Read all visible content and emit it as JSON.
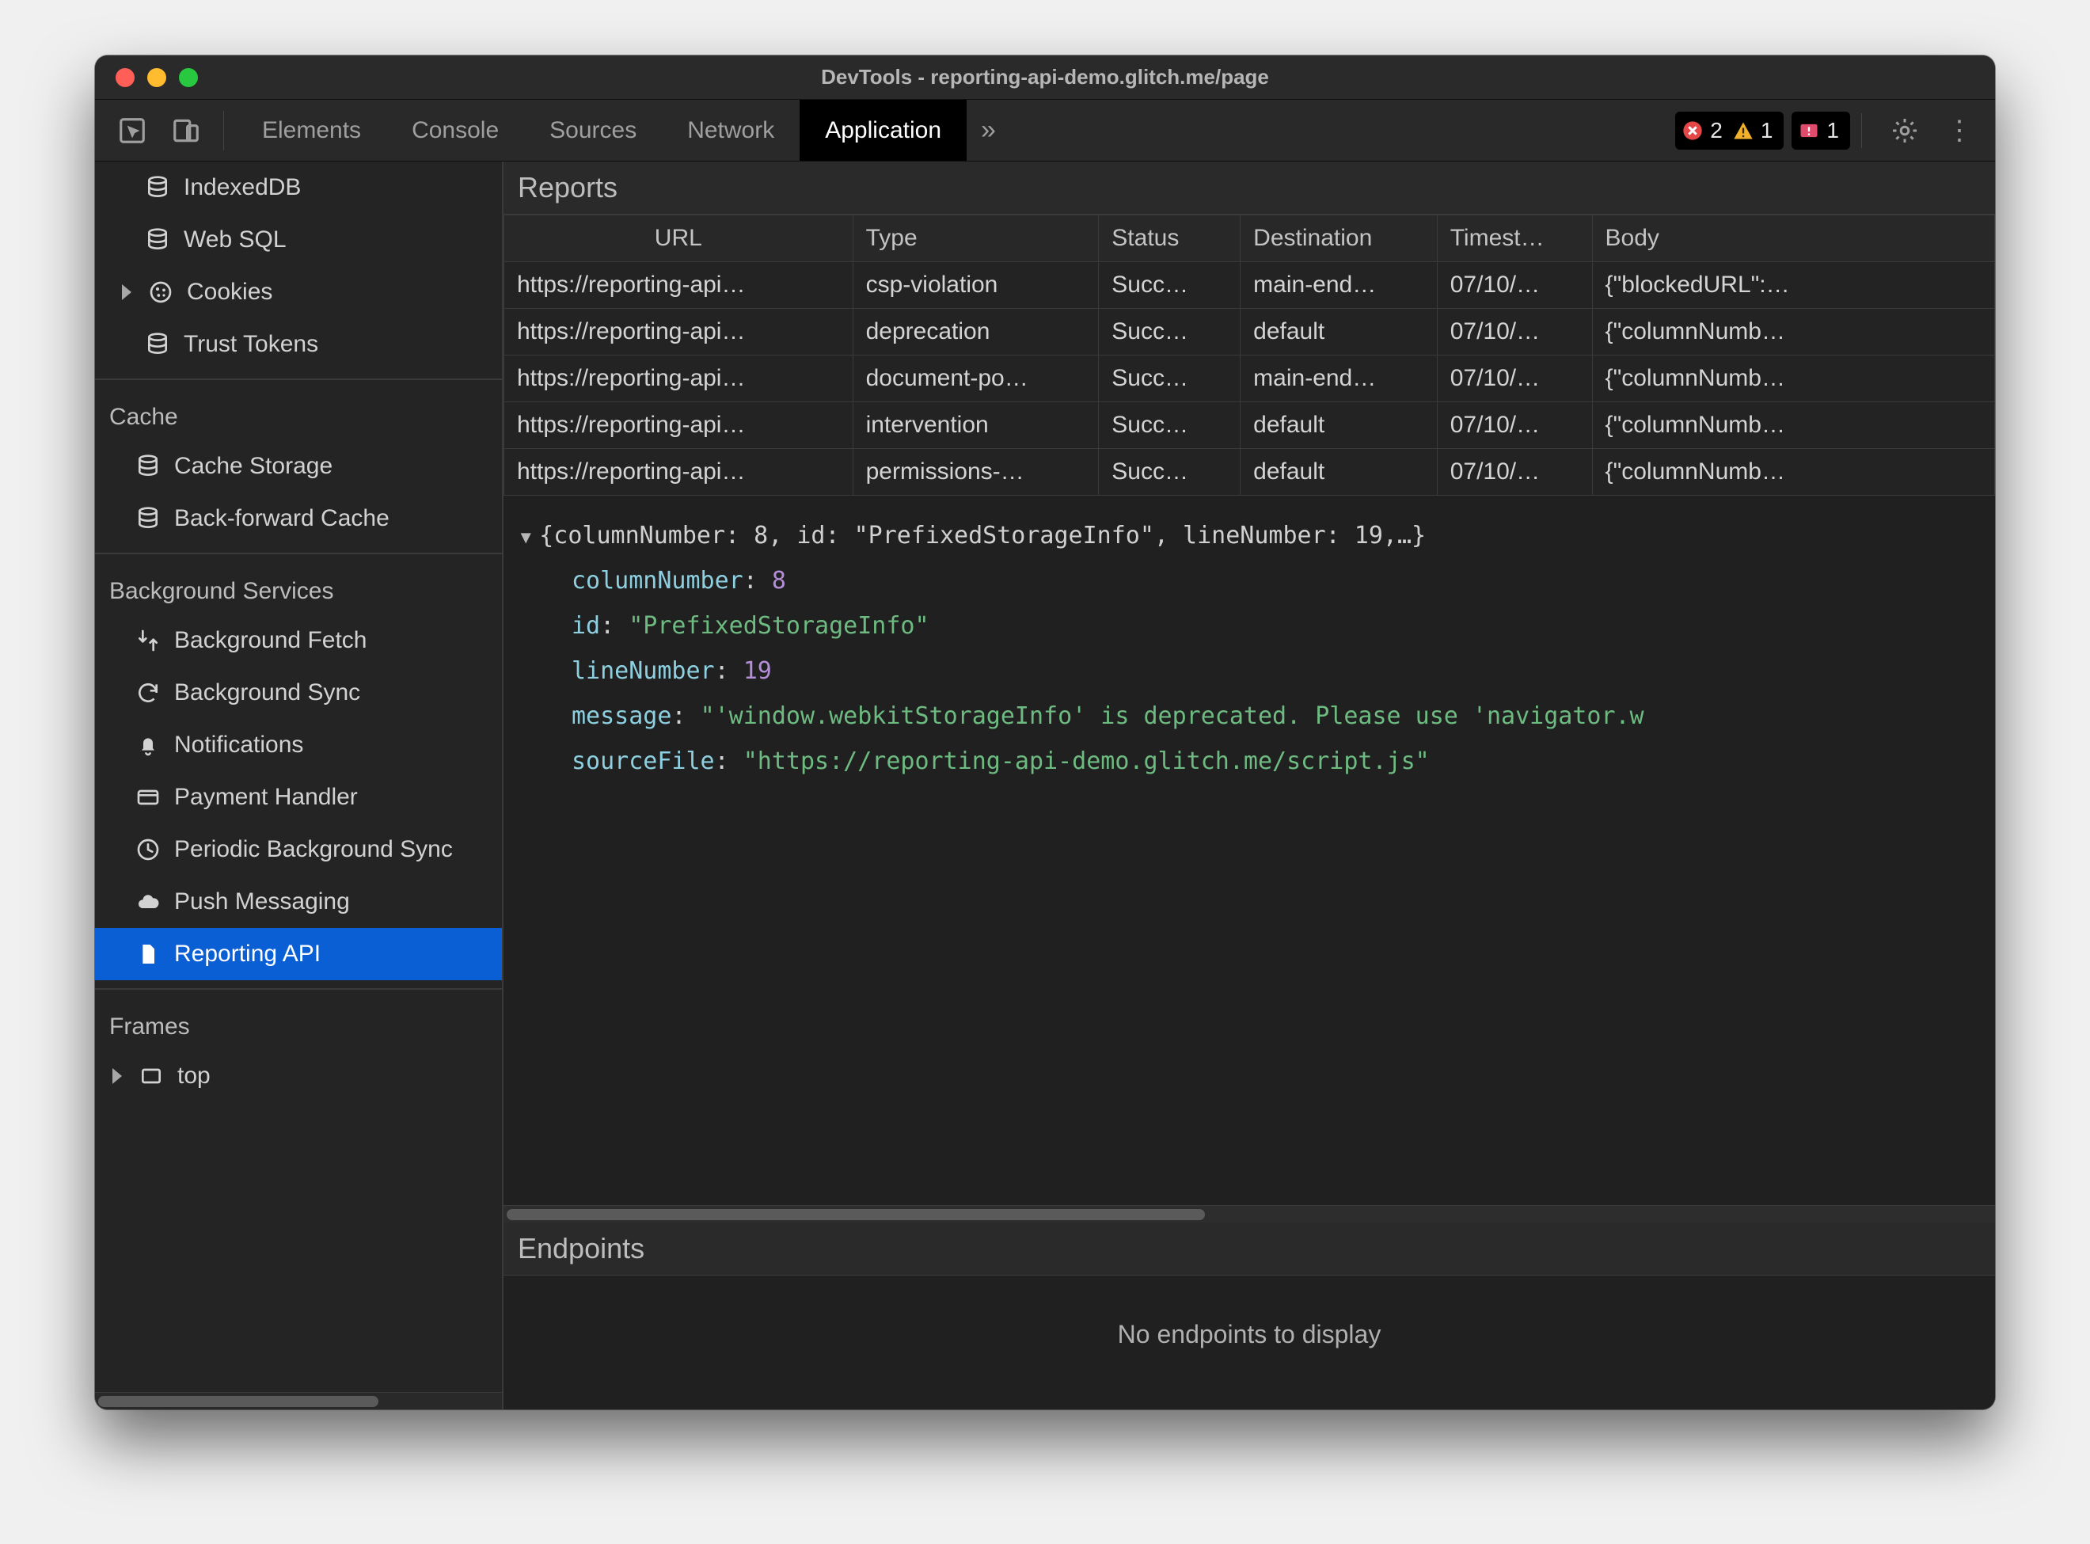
{
  "window": {
    "title": "DevTools - reporting-api-demo.glitch.me/page"
  },
  "toolbar": {
    "tabs": [
      "Elements",
      "Console",
      "Sources",
      "Network",
      "Application"
    ],
    "active_tab_index": 4,
    "errors": 2,
    "warnings": 1,
    "issues": 1
  },
  "sidebar": {
    "top_items": [
      {
        "icon": "database-icon",
        "label": "IndexedDB"
      },
      {
        "icon": "database-icon",
        "label": "Web SQL"
      },
      {
        "icon": "cookie-icon",
        "label": "Cookies",
        "expandable": true
      },
      {
        "icon": "database-icon",
        "label": "Trust Tokens"
      }
    ],
    "groups": [
      {
        "title": "Cache",
        "items": [
          {
            "icon": "database-icon",
            "label": "Cache Storage"
          },
          {
            "icon": "database-icon",
            "label": "Back-forward Cache"
          }
        ]
      },
      {
        "title": "Background Services",
        "items": [
          {
            "icon": "fetch-icon",
            "label": "Background Fetch"
          },
          {
            "icon": "sync-icon",
            "label": "Background Sync"
          },
          {
            "icon": "bell-icon",
            "label": "Notifications"
          },
          {
            "icon": "card-icon",
            "label": "Payment Handler"
          },
          {
            "icon": "clock-icon",
            "label": "Periodic Background Sync"
          },
          {
            "icon": "cloud-icon",
            "label": "Push Messaging"
          },
          {
            "icon": "file-icon",
            "label": "Reporting API",
            "selected": true
          }
        ]
      },
      {
        "title": "Frames",
        "items": [
          {
            "icon": "frame-icon",
            "label": "top",
            "expandable": true
          }
        ]
      }
    ]
  },
  "reports": {
    "section_title": "Reports",
    "columns": [
      "URL",
      "Type",
      "Status",
      "Destination",
      "Timest…",
      "Body"
    ],
    "rows": [
      {
        "url": "https://reporting-api…",
        "type": "csp-violation",
        "status": "Succ…",
        "destination": "main-end…",
        "timestamp": "07/10/…",
        "body": "{\"blockedURL\":…"
      },
      {
        "url": "https://reporting-api…",
        "type": "deprecation",
        "status": "Succ…",
        "destination": "default",
        "timestamp": "07/10/…",
        "body": "{\"columnNumb…"
      },
      {
        "url": "https://reporting-api…",
        "type": "document-po…",
        "status": "Succ…",
        "destination": "main-end…",
        "timestamp": "07/10/…",
        "body": "{\"columnNumb…"
      },
      {
        "url": "https://reporting-api…",
        "type": "intervention",
        "status": "Succ…",
        "destination": "default",
        "timestamp": "07/10/…",
        "body": "{\"columnNumb…"
      },
      {
        "url": "https://reporting-api…",
        "type": "permissions-…",
        "status": "Succ…",
        "destination": "default",
        "timestamp": "07/10/…",
        "body": "{\"columnNumb…"
      }
    ],
    "detail": {
      "summary": "{columnNumber: 8, id: \"PrefixedStorageInfo\", lineNumber: 19,…}",
      "props": [
        {
          "key": "columnNumber",
          "value": "8",
          "kind": "num"
        },
        {
          "key": "id",
          "value": "\"PrefixedStorageInfo\"",
          "kind": "str"
        },
        {
          "key": "lineNumber",
          "value": "19",
          "kind": "num"
        },
        {
          "key": "message",
          "value": "\"'window.webkitStorageInfo' is deprecated. Please use 'navigator.w",
          "kind": "str"
        },
        {
          "key": "sourceFile",
          "value": "\"https://reporting-api-demo.glitch.me/script.js\"",
          "kind": "str"
        }
      ]
    }
  },
  "endpoints": {
    "section_title": "Endpoints",
    "empty_text": "No endpoints to display"
  },
  "bottom_scroll_thumb_width_pct": 47
}
